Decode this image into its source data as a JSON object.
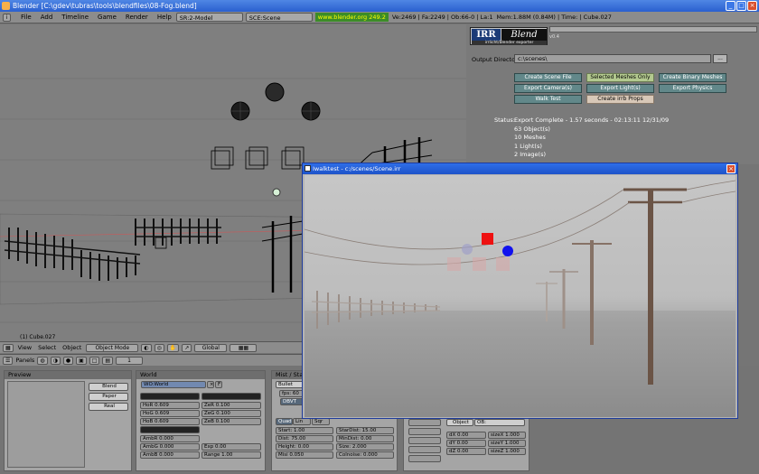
{
  "window": {
    "title": "Blender [C:\\gdev\\tubras\\tools\\blendfiles\\08-Fog.blend]"
  },
  "topbar": {
    "menus": [
      "File",
      "Add",
      "Timeline",
      "Game",
      "Render",
      "Help"
    ],
    "screen": "SR:2-Model",
    "scene": "SCE:Scene",
    "url": "www.blender.org 249.2",
    "stats": "Ve:2469 | Fa:2249 | Ob:66-0 | La:1",
    "mem": "Mem:1.88M (0.84M) | Time: | Cube.027"
  },
  "viewport": {
    "object_label": "(1) Cube.027"
  },
  "irrb": {
    "logo_irr": "IRR",
    "logo_blend": "Blend",
    "logo_sub": "irrlicht/blender exporter",
    "version": "v0.4",
    "output_label": "Output Directory",
    "output_value": "c:\\scenes\\",
    "browse": "...",
    "buttons": {
      "create_scene": "Create Scene File",
      "selected_meshes": "Selected Meshes Only",
      "create_binary": "Create Binary Meshes",
      "export_cameras": "Export Camera(s)",
      "export_lights": "Export Light(s)",
      "export_physics": "Export Physics",
      "walk_test": "Walk Test",
      "create_props": "Create irrb Props"
    },
    "status_label": "Status:",
    "status_lines": [
      "Export Complete - 1.57 seconds - 02:13:11 12/31/09",
      "63 Object(s)",
      "10 Meshes",
      "1 Light(s)",
      "2 Image(s)"
    ]
  },
  "walktest": {
    "title": "Iwalktest - c:/scenes/Scene.irr",
    "close": "×"
  },
  "vpheader": {
    "menus": [
      "View",
      "Select",
      "Object"
    ],
    "mode": "Object Mode",
    "orientation": "Global"
  },
  "btnheader": {
    "panels": "Panels",
    "frame": "1"
  },
  "preview": {
    "title": "Preview",
    "buttons": [
      "Blend",
      "Paper",
      "Real"
    ]
  },
  "world": {
    "title": "World",
    "name": "WO:World",
    "fake": "F",
    "hor": [
      "HoR 0.609",
      "HoG 0.609",
      "HoB 0.609"
    ],
    "zen": [
      "ZeR 0.100",
      "ZeG 0.100",
      "ZeB 0.100"
    ],
    "amb": [
      "AmbR 0.000",
      "AmbG 0.000",
      "AmbB 0.000"
    ],
    "exp": "Exp 0.00",
    "range": "Range 1.00"
  },
  "mist": {
    "title": "Mist / Stars / Physics",
    "physics": "Bullet",
    "fps": "fps: 60",
    "dbvt": "DBVT",
    "tabs": [
      "Quad",
      "Lin",
      "Sqr"
    ],
    "start": "Start: 1.00",
    "dist": "Dist: 75.00",
    "height": "Height: 0.00",
    "misi": "Misi 0.050",
    "stardist": "StarDist: 15.00",
    "mindist": "MinDist: 0.00",
    "size": "Size: 2.000",
    "colnoise": "Colnoise: 0.000"
  },
  "texture": {
    "object_label": "Object",
    "ob": "OB:",
    "dx": "dX 0.00",
    "dy": "dY 0.00",
    "dz": "dZ 0.00",
    "sizex": "sizeX 1.000",
    "sizey": "sizeY 1.000",
    "sizez": "sizeZ 1.000"
  }
}
